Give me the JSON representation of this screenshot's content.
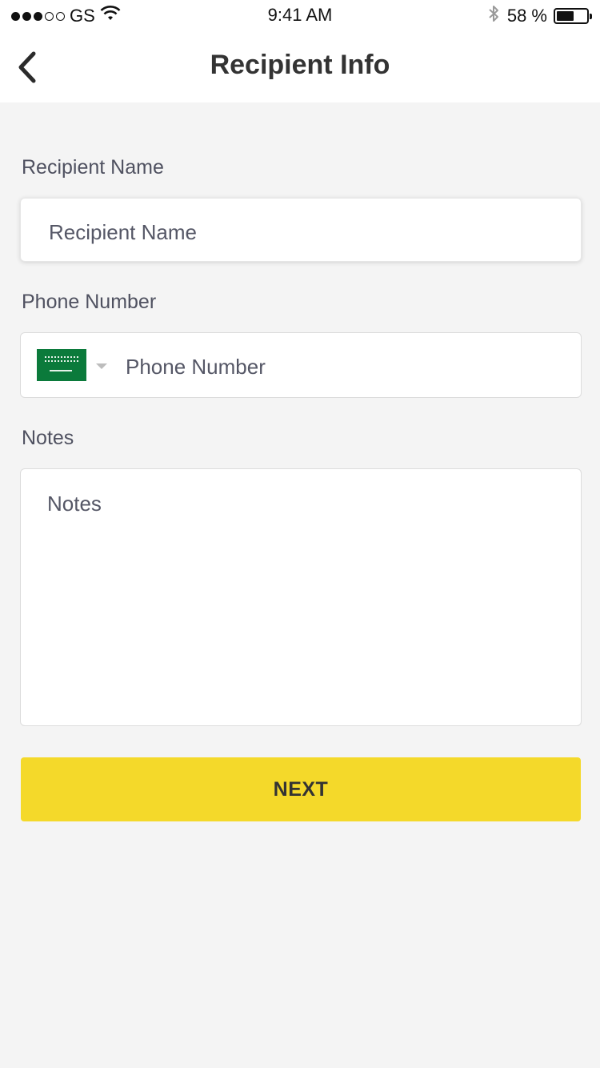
{
  "status_bar": {
    "carrier": "GS",
    "time": "9:41 AM",
    "battery_text": "58 %",
    "battery_level": 0.58,
    "signal_strength": 3,
    "signal_max": 5,
    "icons": [
      "wifi-icon",
      "bluetooth-icon",
      "battery-icon"
    ]
  },
  "header": {
    "title": "Recipient Info",
    "back_icon": "chevron-left-icon"
  },
  "form": {
    "name_label": "Recipient Name",
    "name_placeholder": "Recipient Name",
    "phone_label": "Phone Number",
    "phone_placeholder": "Phone Number",
    "phone_country_flag": "saudi-arabia-flag",
    "notes_label": "Notes",
    "notes_placeholder": "Notes",
    "next_label": "NEXT"
  },
  "colors": {
    "background": "#f4f4f4",
    "accent": "#f4d92a",
    "label": "#4f5160",
    "flag_green": "#0b7a3b"
  }
}
